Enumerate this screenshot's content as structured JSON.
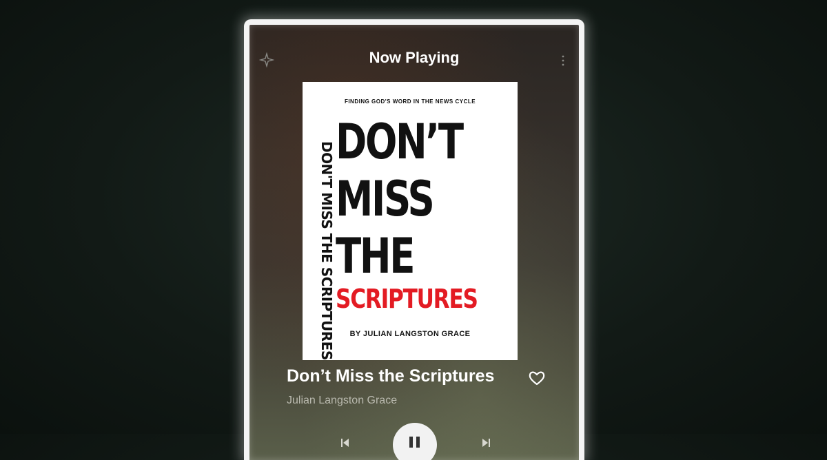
{
  "header": {
    "title": "Now Playing"
  },
  "cover": {
    "tagline": "FINDING GOD'S WORD IN THE NEWS CYCLE",
    "vertical_title": "DON'T MISS THE SCRIPTURES",
    "line1": "DON’T",
    "line2": "MISS",
    "line3": "THE",
    "line4": "SCRIPTURES",
    "author": "BY JULIAN LANGSTON GRACE",
    "accent_color": "#e31b23"
  },
  "track": {
    "title": "Don’t Miss the Scriptures",
    "artist": "Julian Langston Grace"
  },
  "icons": {
    "top_left": "sparkle-icon",
    "top_right": "more-vertical-icon",
    "favorite": "heart-icon",
    "play": "pause-icon"
  }
}
